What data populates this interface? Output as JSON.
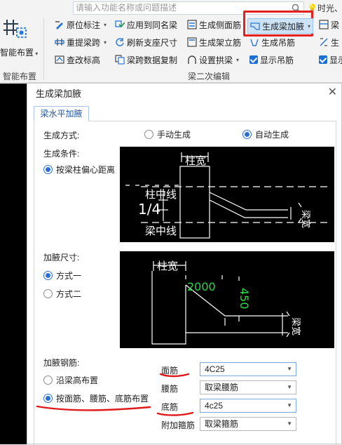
{
  "ribbon": {
    "search_placeholder": "请输入功能名称或问题描述",
    "user": "时光、背",
    "smart_layout": "智能布置",
    "group_smart": "智能布置",
    "group_beam2": "梁二次编辑",
    "col1": [
      "原位标注",
      "重提梁跨",
      "查改标高"
    ],
    "col2": [
      "应用到同名梁",
      "刷新支座尺寸",
      "梁跨数据复制"
    ],
    "col3": [
      "生成侧面筋",
      "生成架立筋",
      "设置拱梁"
    ],
    "col4": [
      "生成梁加腋",
      "生成吊筋",
      "显示吊筋"
    ],
    "col5": [
      "梁",
      "生",
      "显示"
    ]
  },
  "dialog": {
    "title": "生成梁加腋",
    "tab": "梁水平加腋",
    "gen_method_label": "生成方式:",
    "gen_manual": "手动生成",
    "gen_auto": "自动生成",
    "gen_condition_label": "生成条件:",
    "gen_condition_option": "按梁柱偏心距离",
    "diagram1": {
      "col_width": "柱宽",
      "col_center": "柱中线",
      "ratio": "1/4",
      "beam_center": "梁中线",
      "beam_width": "梁宽"
    },
    "size_label": "加腋尺寸:",
    "size_opt1": "方式一",
    "size_opt2": "方式二",
    "diagram2": {
      "col_width": "柱宽",
      "len": "2000",
      "depth": "450",
      "beam_width": "梁宽"
    },
    "rebar_label": "加腋钢筋:",
    "rebar_opt1": "沿梁高布置",
    "rebar_opt2": "按面筋、腰筋、底筋布置",
    "rebar_rows": [
      {
        "label": "面筋",
        "value": "4C25"
      },
      {
        "label": "腰筋",
        "value": "取梁腰筋"
      },
      {
        "label": "底筋",
        "value": "4c25"
      },
      {
        "label": "附加箍筋",
        "value": "取梁箍筋"
      }
    ]
  }
}
